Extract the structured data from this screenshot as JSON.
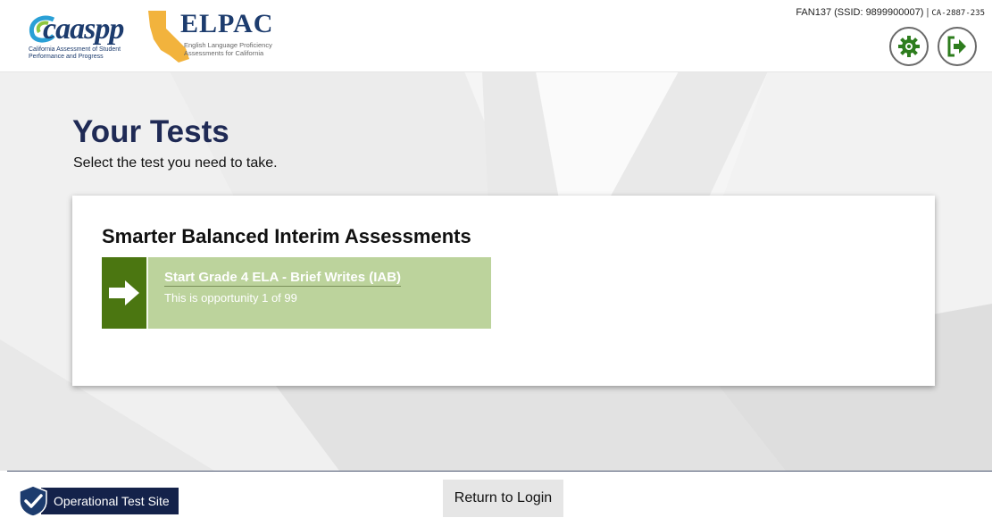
{
  "header": {
    "caaspp_logo_text": "caaspp",
    "caaspp_subtitle": "California Assessment of Student Performance and Progress",
    "elpac_logo_text": "ELPAC",
    "elpac_subtitle": "English Language Proficiency Assessments for California",
    "user_id": "FAN137 (SSID: 9899900007)",
    "separator": "|",
    "session_code": "CA-2887-235",
    "settings_icon": "gear-icon",
    "logout_icon": "logout-icon"
  },
  "main": {
    "title": "Your Tests",
    "subtitle": "Select the test you need to take.",
    "card": {
      "heading": "Smarter Balanced Interim Assessments",
      "test": {
        "name": "Start Grade 4 ELA - Brief Writes (IAB)",
        "opportunity": "This is opportunity 1 of 99",
        "icon": "arrow-right-icon"
      }
    }
  },
  "footer": {
    "site_label": "Operational Test Site",
    "return_button": "Return to Login"
  },
  "colors": {
    "title": "#1f2a55",
    "test_button_bg": "#bcd39c",
    "arrow_bg": "#4b7611",
    "site_badge_bg": "#14224a",
    "shield": "#1d3c6e"
  }
}
